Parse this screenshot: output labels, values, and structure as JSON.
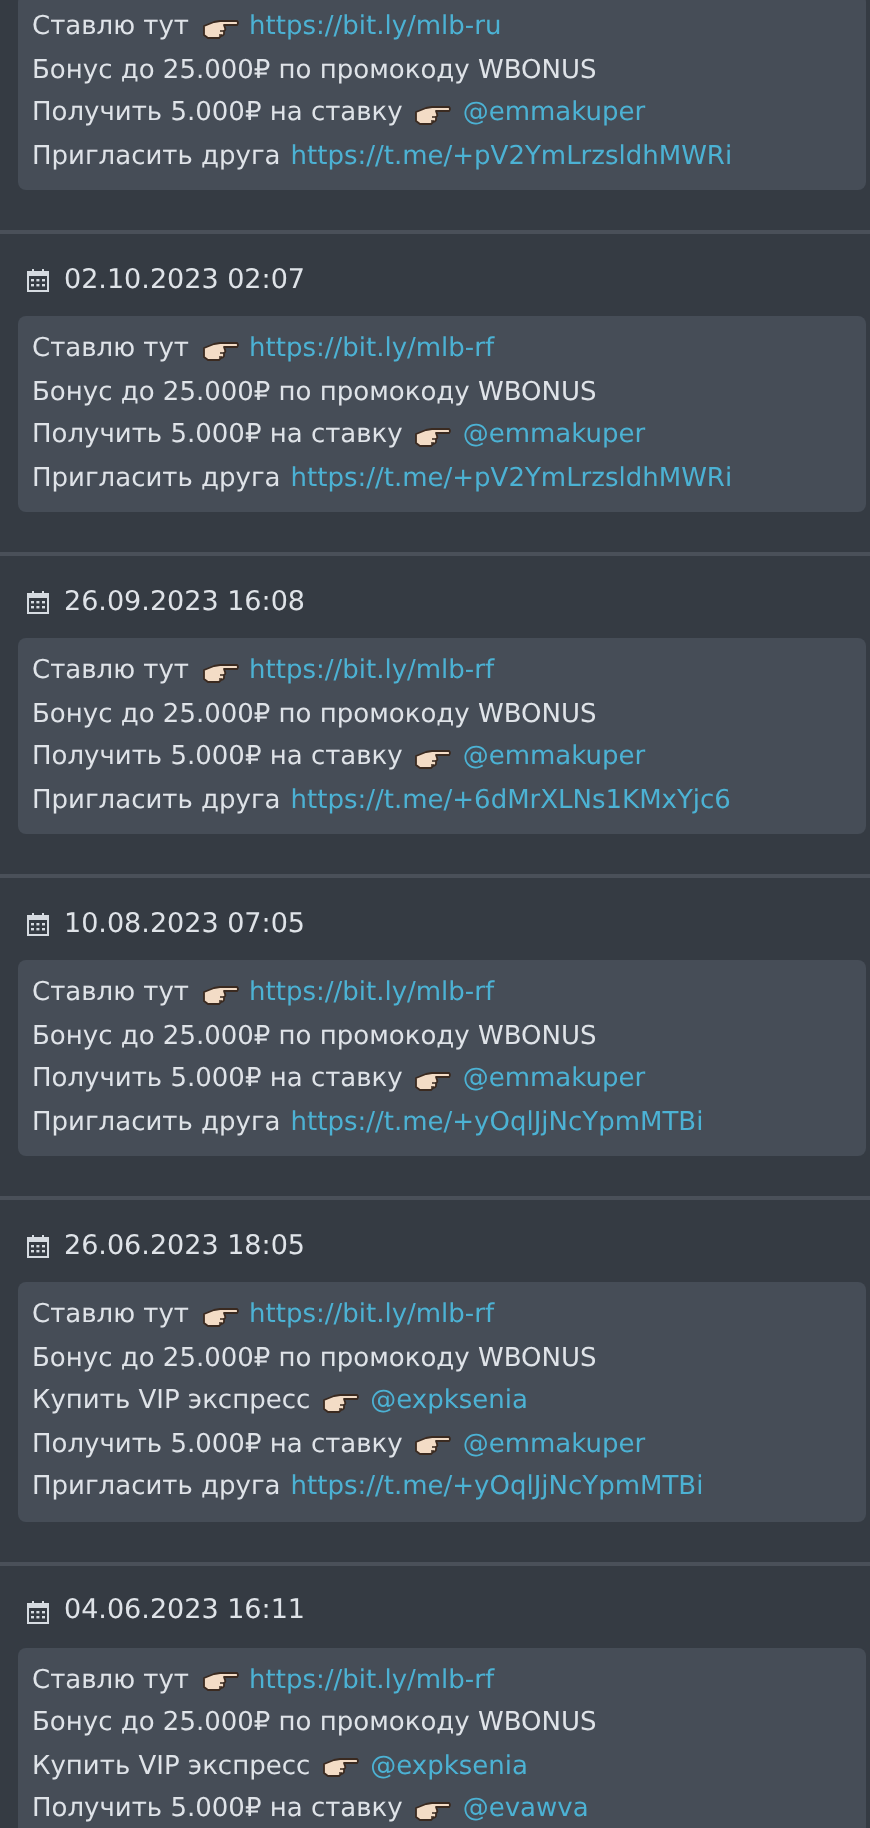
{
  "posts": [
    {
      "lines": [
        {
          "text": "Ставлю тут",
          "pointer": true,
          "link": "https://bit.ly/mlb-ru"
        },
        {
          "text": "Бонус до 25.000₽ по промокоду WBONUS"
        },
        {
          "text": "Получить 5.000₽ на ставку",
          "pointer": true,
          "link": "@emmakuper"
        },
        {
          "text": "Пригласить друга",
          "link": "https://t.me/+pV2YmLrzsldhMWRi"
        }
      ]
    },
    {
      "date": "02.10.2023 02:07",
      "lines": [
        {
          "text": "Ставлю тут",
          "pointer": true,
          "link": "https://bit.ly/mlb-rf"
        },
        {
          "text": "Бонус до 25.000₽ по промокоду WBONUS"
        },
        {
          "text": "Получить 5.000₽ на ставку",
          "pointer": true,
          "link": "@emmakuper"
        },
        {
          "text": "Пригласить друга",
          "link": "https://t.me/+pV2YmLrzsldhMWRi"
        }
      ]
    },
    {
      "date": "26.09.2023 16:08",
      "lines": [
        {
          "text": "Ставлю тут",
          "pointer": true,
          "link": "https://bit.ly/mlb-rf"
        },
        {
          "text": "Бонус до 25.000₽ по промокоду WBONUS"
        },
        {
          "text": "Получить 5.000₽ на ставку",
          "pointer": true,
          "link": "@emmakuper"
        },
        {
          "text": "Пригласить друга",
          "link": "https://t.me/+6dMrXLNs1KMxYjc6"
        }
      ]
    },
    {
      "date": "10.08.2023 07:05",
      "lines": [
        {
          "text": "Ставлю тут",
          "pointer": true,
          "link": "https://bit.ly/mlb-rf"
        },
        {
          "text": "Бонус до 25.000₽ по промокоду WBONUS"
        },
        {
          "text": "Получить 5.000₽ на ставку",
          "pointer": true,
          "link": "@emmakuper"
        },
        {
          "text": "Пригласить друга",
          "link": "https://t.me/+yOqlJjNcYpmMTBi"
        }
      ]
    },
    {
      "date": "26.06.2023 18:05",
      "lines": [
        {
          "text": "Ставлю тут",
          "pointer": true,
          "link": "https://bit.ly/mlb-rf"
        },
        {
          "text": "Бонус до 25.000₽ по промокоду WBONUS"
        },
        {
          "text": "Купить VIP экспресс",
          "pointer": true,
          "link": "@expksenia"
        },
        {
          "text": "Получить 5.000₽ на ставку",
          "pointer": true,
          "link": "@emmakuper"
        },
        {
          "text": "Пригласить друга",
          "link": "https://t.me/+yOqlJjNcYpmMTBi"
        }
      ]
    },
    {
      "date": "04.06.2023 16:11",
      "lines": [
        {
          "text": "Ставлю тут",
          "pointer": true,
          "link": "https://bit.ly/mlb-rf"
        },
        {
          "text": "Бонус до 25.000₽ по промокоду WBONUS"
        },
        {
          "text": "Купить VIP экспресс",
          "pointer": true,
          "link": "@expksenia"
        },
        {
          "text": "Получить 5.000₽ на ставку",
          "pointer": true,
          "link": "@evawva"
        }
      ]
    }
  ]
}
